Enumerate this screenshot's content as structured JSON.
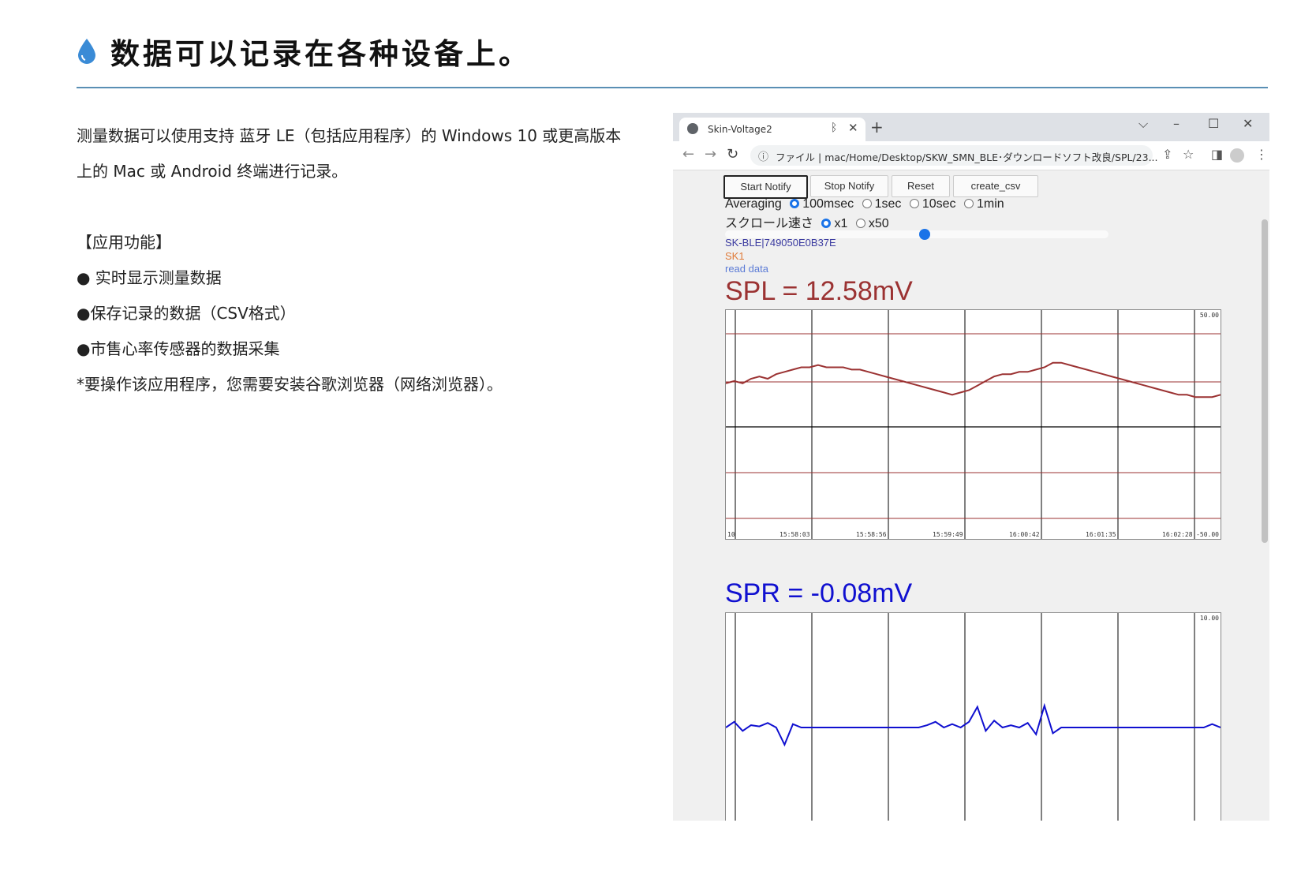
{
  "heading": {
    "title": "数据可以记录在各种设备上。",
    "icon": "water-drop-icon",
    "icon_color": "#3a8bd6"
  },
  "intro": {
    "line1": "测量数据可以使用支持 蓝牙 LE（包括应用程序）的 Windows 10 或更高版本",
    "line2": "上的 Mac 或 Android 终端进行记录。"
  },
  "features": {
    "title": "【应用功能】",
    "items": [
      "● 实时显示测量数据",
      "●保存记录的数据（CSV格式）",
      "●市售心率传感器的数据采集"
    ],
    "note": "*要操作该应用程序，您需要安装谷歌浏览器（网络浏览器）。"
  },
  "browser": {
    "tab_title": "Skin-Voltage2",
    "new_tab": "+",
    "address_prefix": "ファイル",
    "address": "mac/Home/Desktop/SKW_SMN_BLE･ダウンロードソフト改良/SPL/23...",
    "win_chevron": "⌵",
    "win_min": "–",
    "win_max": "☐",
    "win_close": "✕"
  },
  "app": {
    "buttons": {
      "start": "Start Notify",
      "stop": "Stop Notify",
      "reset": "Reset",
      "csv": "create_csv"
    },
    "averaging": {
      "label": "Averaging",
      "options": [
        "100msec",
        "1sec",
        "10sec",
        "1min"
      ],
      "selected": "100msec"
    },
    "scroll": {
      "label": "スクロール速さ",
      "options": [
        "x1",
        "x50"
      ],
      "selected": "x1"
    },
    "slider_value": 0.52,
    "device": "SK-BLE|749050E0B37E",
    "sensor": "SK1",
    "status": "read data",
    "spl_readout": "SPL = 12.58mV",
    "spr_readout": "SPR = -0.08mV",
    "colors": {
      "spl": "#9b3232",
      "spr": "#1010d0",
      "device": "#3a3aa0",
      "sensor": "#e07b39",
      "status": "#5b7bd6"
    }
  },
  "chart_data": [
    {
      "type": "line",
      "title": "SPL = 12.58mV",
      "ylim": [
        -50,
        50
      ],
      "ymax_label": "50.00",
      "ymin_label": "-50.00",
      "x_first_label": "10",
      "xticks": [
        "15:58:03",
        "15:58:56",
        "15:59:49",
        "16:00:42",
        "16:01:35",
        "16:02:28"
      ],
      "grid": true,
      "series": [
        {
          "color": "#9b3232",
          "values": [
            18,
            19,
            18,
            20,
            21,
            20,
            22,
            23,
            24,
            25,
            25,
            26,
            25,
            25,
            25,
            24,
            24,
            23,
            22,
            21,
            20,
            19,
            18,
            17,
            16,
            15,
            14,
            13,
            14,
            15,
            17,
            19,
            21,
            22,
            22,
            23,
            23,
            24,
            25,
            27,
            27,
            26,
            25,
            24,
            23,
            22,
            21,
            20,
            19,
            18,
            17,
            16,
            15,
            14,
            13,
            13,
            12,
            12,
            12,
            13
          ]
        }
      ]
    },
    {
      "type": "line",
      "title": "SPR = -0.08mV",
      "ylim": [
        -10,
        10
      ],
      "ymax_label": "10.00",
      "series": [
        {
          "color": "#1010d0",
          "values": [
            0,
            0.5,
            -0.3,
            0.2,
            0.1,
            0.4,
            0,
            -1.5,
            0.3,
            0,
            0,
            0,
            0,
            0,
            0,
            0,
            0,
            0,
            0,
            0,
            0,
            0,
            0,
            0,
            0.2,
            0.5,
            0,
            0.3,
            0,
            0.5,
            1.8,
            -0.3,
            0.6,
            0,
            0.2,
            0,
            0.4,
            -0.6,
            1.9,
            -0.5,
            0,
            0,
            0,
            0,
            0,
            0,
            0,
            0,
            0,
            0,
            0,
            0,
            0,
            0,
            0,
            0,
            0,
            0,
            0.3,
            0
          ]
        }
      ]
    }
  ]
}
